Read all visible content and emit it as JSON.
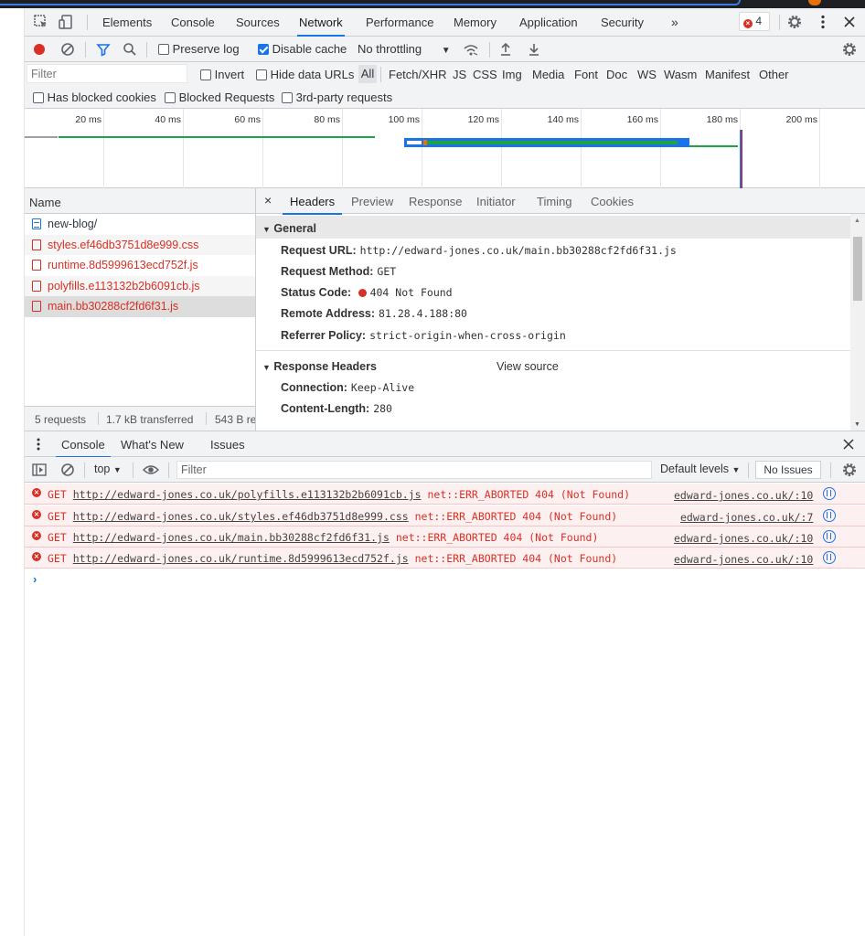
{
  "main_tabs": [
    "Elements",
    "Console",
    "Sources",
    "Network",
    "Performance",
    "Memory",
    "Application",
    "Security"
  ],
  "active_main_tab": "Network",
  "more_tabs_glyph": "»",
  "error_count": "4",
  "network_toolbar": {
    "preserve_log_label": "Preserve log",
    "preserve_log_checked": false,
    "disable_cache_label": "Disable cache",
    "disable_cache_checked": true,
    "throttling_label": "No throttling"
  },
  "filter": {
    "placeholder": "Filter",
    "invert_label": "Invert",
    "hide_data_urls_label": "Hide data URLs",
    "types": [
      "All",
      "Fetch/XHR",
      "JS",
      "CSS",
      "Img",
      "Media",
      "Font",
      "Doc",
      "WS",
      "Wasm",
      "Manifest",
      "Other"
    ],
    "has_blocked_cookies_label": "Has blocked cookies",
    "blocked_requests_label": "Blocked Requests",
    "third_party_label": "3rd-party requests"
  },
  "overview": {
    "ticks": [
      "20 ms",
      "40 ms",
      "60 ms",
      "80 ms",
      "100 ms",
      "120 ms",
      "140 ms",
      "160 ms",
      "180 ms",
      "200 ms"
    ],
    "colors": {
      "green": "#1ea446",
      "blue": "#1a73e8",
      "load_line": "#c5221f",
      "dcl_line": "#3367d6"
    }
  },
  "requests": {
    "column_name": "Name",
    "items": [
      {
        "name": "new-blog/",
        "type": "doc",
        "error": false
      },
      {
        "name": "styles.ef46db3751d8e999.css",
        "type": "css",
        "error": true
      },
      {
        "name": "runtime.8d5999613ecd752f.js",
        "type": "js",
        "error": true
      },
      {
        "name": "polyfills.e113132b2b6091cb.js",
        "type": "js",
        "error": true
      },
      {
        "name": "main.bb30288cf2fd6f31.js",
        "type": "js",
        "error": true
      }
    ],
    "status": {
      "requests": "5 requests",
      "transferred": "1.7 kB transferred",
      "resources": "543 B re"
    }
  },
  "details": {
    "close_glyph": "×",
    "tabs": [
      "Headers",
      "Preview",
      "Response",
      "Initiator",
      "Timing",
      "Cookies"
    ],
    "active_tab": "Headers",
    "general": {
      "title": "General",
      "request_url_label": "Request URL:",
      "request_url": "http://edward-jones.co.uk/main.bb30288cf2fd6f31.js",
      "request_method_label": "Request Method:",
      "request_method": "GET",
      "status_code_label": "Status Code:",
      "status_code": "404 Not Found",
      "remote_address_label": "Remote Address:",
      "remote_address": "81.28.4.188:80",
      "referrer_policy_label": "Referrer Policy:",
      "referrer_policy": "strict-origin-when-cross-origin"
    },
    "response_headers": {
      "title": "Response Headers",
      "view_source": "View source",
      "connection_label": "Connection:",
      "connection": "Keep-Alive",
      "content_length_label": "Content-Length:",
      "content_length": "280"
    }
  },
  "drawer": {
    "tabs": [
      "Console",
      "What's New",
      "Issues"
    ],
    "active_tab": "Console",
    "context": "top",
    "filter_placeholder": "Filter",
    "levels": "Default levels",
    "no_issues": "No Issues"
  },
  "console_messages": [
    {
      "method": "GET",
      "url": "http://edward-jones.co.uk/polyfills.e113132b2b6091cb.js",
      "error": "net::ERR_ABORTED 404 (Not Found)",
      "source": "edward-jones.co.uk/:10"
    },
    {
      "method": "GET",
      "url": "http://edward-jones.co.uk/styles.ef46db3751d8e999.css",
      "error": "net::ERR_ABORTED 404 (Not Found)",
      "source": "edward-jones.co.uk/:7"
    },
    {
      "method": "GET",
      "url": "http://edward-jones.co.uk/main.bb30288cf2fd6f31.js",
      "error": "net::ERR_ABORTED 404 (Not Found)",
      "source": "edward-jones.co.uk/:10"
    },
    {
      "method": "GET",
      "url": "http://edward-jones.co.uk/runtime.8d5999613ecd752f.js",
      "error": "net::ERR_ABORTED 404 (Not Found)",
      "source": "edward-jones.co.uk/:10"
    }
  ],
  "console_prompt": "›"
}
